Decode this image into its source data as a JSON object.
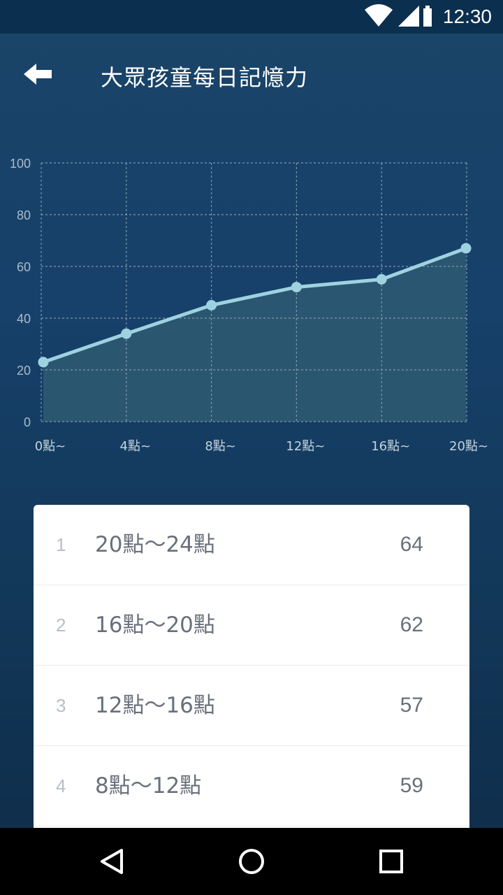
{
  "status_bar": {
    "time": "12:30",
    "icons": [
      "wifi-icon",
      "signal-icon",
      "battery-icon"
    ]
  },
  "header": {
    "title": "大眾孩童每日記憶力",
    "back_icon": "arrow-left-icon"
  },
  "chart_data": {
    "type": "area",
    "title": "",
    "xlabel": "",
    "ylabel": "",
    "categories": [
      "0點~",
      "4點~",
      "8點~",
      "12點~",
      "16點~",
      "20點~"
    ],
    "values": [
      23,
      34,
      45,
      52,
      55,
      67
    ],
    "ylim": [
      0,
      100
    ],
    "yticks": [
      0,
      20,
      40,
      60,
      80,
      100
    ],
    "grid": true,
    "line_color": "#9fd2e0",
    "fill_color": "#2f5a72"
  },
  "list": [
    {
      "index": "1",
      "range": "20點～24點",
      "value": "64"
    },
    {
      "index": "2",
      "range": "16點～20點",
      "value": "62"
    },
    {
      "index": "3",
      "range": "12點～16點",
      "value": "57"
    },
    {
      "index": "4",
      "range": "8點～12點",
      "value": "59"
    }
  ],
  "nav_bar": {
    "icons": [
      "back-triangle-icon",
      "home-circle-icon",
      "recents-square-icon"
    ]
  }
}
